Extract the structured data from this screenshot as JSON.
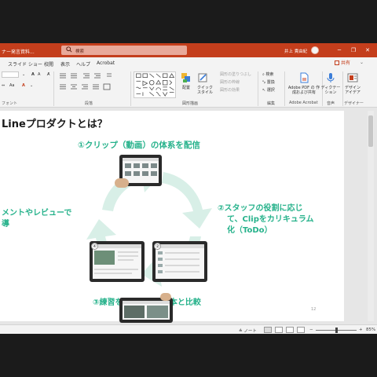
{
  "window": {
    "doc_title": "ナー発言資料...",
    "search_placeholder": "検索",
    "user_name": "井上 貴由紀",
    "controls": [
      "─",
      "❐",
      "✕"
    ]
  },
  "tabs": [
    "スライド ショー",
    "校閲",
    "表示",
    "ヘルプ",
    "Acrobat"
  ],
  "share_label": "共有",
  "ribbon": {
    "groups": {
      "font": "フォント",
      "paragraph": "段落",
      "drawing": "図形描画",
      "editing": "編集",
      "acrobat": "Adobe Acrobat",
      "voice": "音声",
      "designer": "デザイナー"
    },
    "arrange_label": "配置",
    "quick_styles_label": "クイック スタイル",
    "shape_fill": "図形の塗りつぶし",
    "shape_outline": "図形の枠線",
    "shape_effects": "図形の効果",
    "find": "検索",
    "replace": "置換",
    "select": "選択",
    "acrobat_btn": "Adobe PDF の 作成および共有",
    "dictate_btn": "ディクテーション",
    "design_btn": "デザイン アイデア"
  },
  "slide": {
    "title": "Lineプロダクトとは？",
    "step1": "①クリップ（動画）の体系を配信",
    "step2_lines": [
      "②スタッフの役割に応じ",
      "て、Clipをカリキュラム",
      "化（ToDo）"
    ],
    "step3": "③練習を撮影してお手本と比較",
    "step4_lines": [
      "メントやレビューで",
      "導"
    ],
    "page_number": "12",
    "badges": [
      "④",
      "②"
    ]
  },
  "status": {
    "notes_label": "ノート",
    "zoom": "85%",
    "zoom_minus": "−",
    "zoom_plus": "+"
  },
  "colors": {
    "accent": "#c43e1c",
    "teal": "#26b28b",
    "cycle_light": "#d8efe7"
  }
}
